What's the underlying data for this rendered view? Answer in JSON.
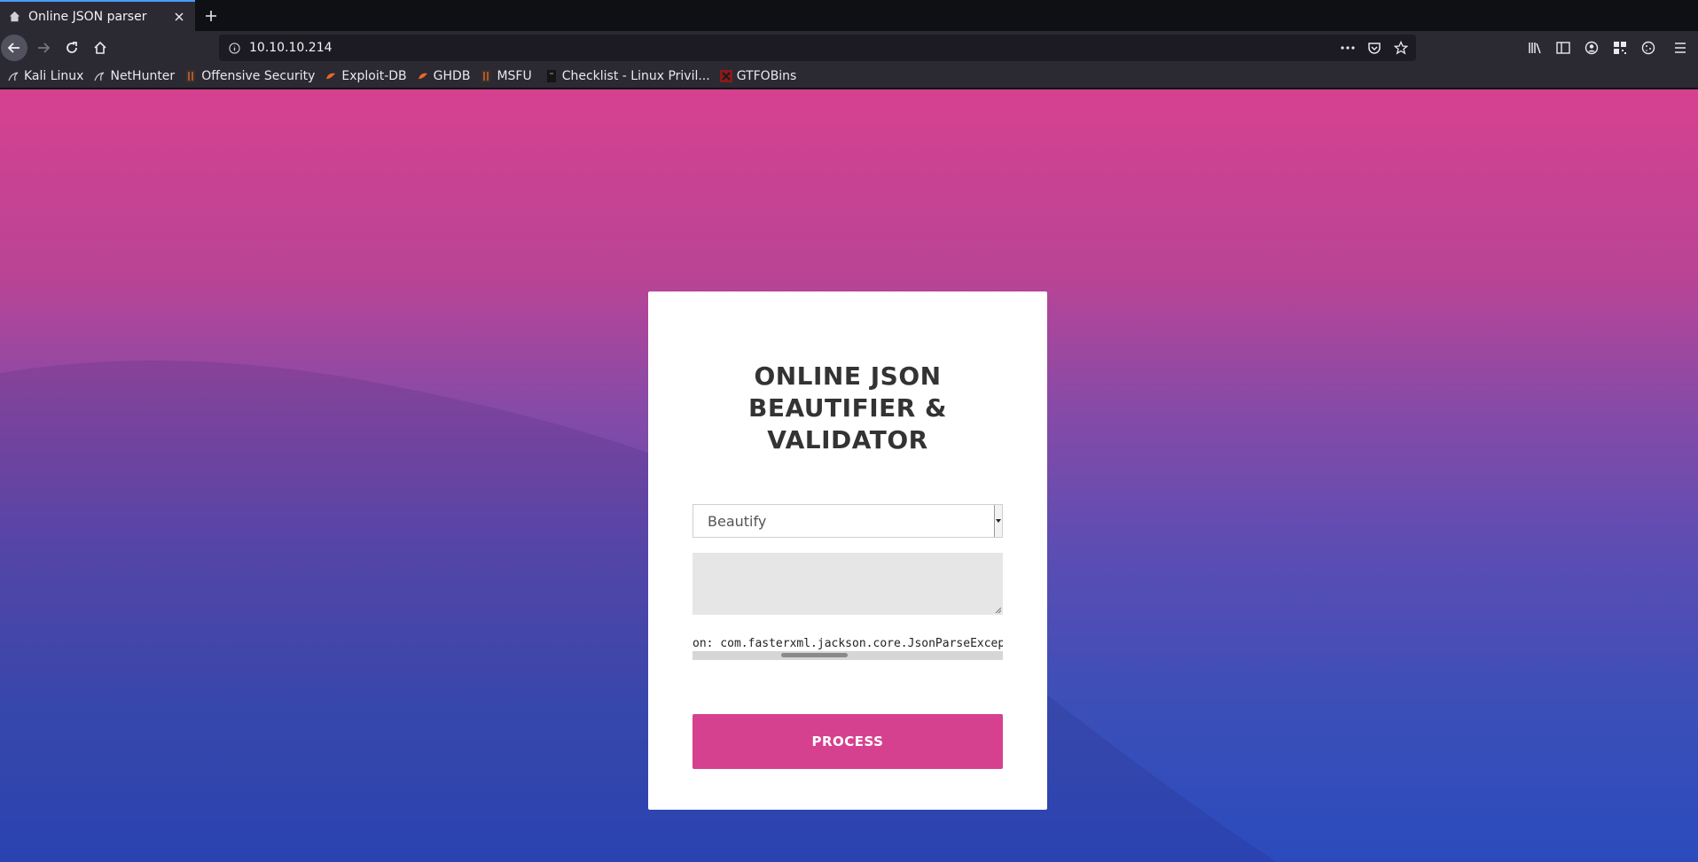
{
  "browser": {
    "tab": {
      "title": "Online JSON parser"
    },
    "address_bar": {
      "url": "10.10.10.214"
    },
    "bookmarks": [
      {
        "label": "Kali Linux",
        "icon": "kali-icon"
      },
      {
        "label": "NetHunter",
        "icon": "nethunter-icon"
      },
      {
        "label": "Offensive Security",
        "icon": "offsec-icon"
      },
      {
        "label": "Exploit-DB",
        "icon": "exploitdb-icon"
      },
      {
        "label": "GHDB",
        "icon": "ghdb-icon"
      },
      {
        "label": "MSFU",
        "icon": "msfu-icon"
      },
      {
        "label": "Checklist - Linux Privil...",
        "icon": "checklist-icon"
      },
      {
        "label": "GTFOBins",
        "icon": "gtfobins-icon"
      }
    ]
  },
  "page": {
    "title_lines": [
      "ONLINE JSON",
      "BEAUTIFIER &",
      "VALIDATOR"
    ],
    "mode_select": {
      "value": "Beautify"
    },
    "input_text": "",
    "output_text": "on: com.fasterxml.jackson.core.JsonParseExcep",
    "process_button": "PROCESS"
  },
  "colors": {
    "accent": "#d6418f",
    "gradient_top": "#d6418f",
    "gradient_bottom": "#2b4bbd"
  }
}
